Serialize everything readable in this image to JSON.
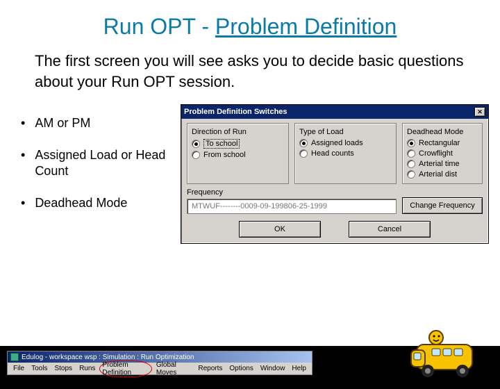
{
  "title": {
    "prefix": "Run OPT - ",
    "underlined": "Problem Definition"
  },
  "subtitle": "The first screen you will see asks you to decide basic questions about your Run OPT session.",
  "bullets": [
    "AM or PM",
    "Assigned Load or Head Count",
    "Deadhead Mode"
  ],
  "dialog": {
    "title": "Problem Definition Switches",
    "groups": {
      "direction": {
        "label": "Direction of Run",
        "options": [
          "To school",
          "From school"
        ],
        "selected": 0
      },
      "load": {
        "label": "Type of Load",
        "options": [
          "Assigned loads",
          "Head counts"
        ],
        "selected": 0
      },
      "deadhead": {
        "label": "Deadhead Mode",
        "options": [
          "Rectangular",
          "Crowflight",
          "Arterial time",
          "Arterial dist"
        ],
        "selected": 0
      }
    },
    "frequency": {
      "label": "Frequency",
      "value": "MTWUF--------0009-09-199806-25-1999",
      "change_label": "Change Frequency"
    },
    "ok_label": "OK",
    "cancel_label": "Cancel"
  },
  "menubar": {
    "title": "Edulog - workspace wsp : Simulation : Run Optimization",
    "items": [
      "File",
      "Tools",
      "Stops",
      "Runs",
      "Problem Definition",
      "Global Moves",
      "Reports",
      "Options",
      "Window",
      "Help"
    ],
    "circled_index": 4
  }
}
